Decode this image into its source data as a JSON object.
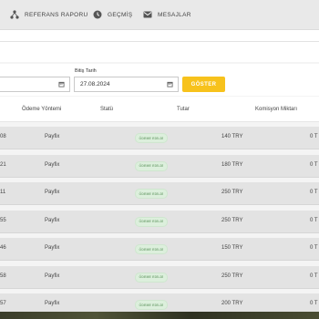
{
  "nav": {
    "items": [
      {
        "label": "REFERANS RAPORU",
        "icon": "network-icon"
      },
      {
        "label": "GEÇMİŞ",
        "icon": "history-icon"
      },
      {
        "label": "MESAJLAR",
        "icon": "mail-icon"
      }
    ]
  },
  "filters": {
    "start_value": "",
    "end_label": "Bitiş Tarih",
    "end_value": "27.08.2024",
    "show_button": "GÖSTER"
  },
  "table": {
    "headers": [
      "Ödeme Yöntemi",
      "Statü",
      "Tutar",
      "Komisyon Miktarı"
    ],
    "rows": [
      {
        "id_tail": "08",
        "method": "Payfix",
        "status": "ÖDEME EDİLDİ",
        "amount": "140 TRY",
        "commission": "0 T"
      },
      {
        "id_tail": "21",
        "method": "Payfix",
        "status": "ÖDEME EDİLDİ",
        "amount": "180 TRY",
        "commission": "0 T"
      },
      {
        "id_tail": "11",
        "method": "Payfix",
        "status": "ÖDEME EDİLDİ",
        "amount": "250 TRY",
        "commission": "0 T"
      },
      {
        "id_tail": "55",
        "method": "Payfix",
        "status": "ÖDEME EDİLDİ",
        "amount": "250 TRY",
        "commission": "0 T"
      },
      {
        "id_tail": "46",
        "method": "Payfix",
        "status": "ÖDEME EDİLDİ",
        "amount": "150 TRY",
        "commission": "0 T"
      },
      {
        "id_tail": "58",
        "method": "Payfix",
        "status": "ÖDEME EDİLDİ",
        "amount": "250 TRY",
        "commission": "0 T"
      },
      {
        "id_tail": "57",
        "method": "Payfix",
        "status": "ÖDEME EDİLDİ",
        "amount": "200 TRY",
        "commission": "0 T"
      }
    ]
  },
  "colors": {
    "accent": "#f7c21c",
    "row_bg": "#e3e3e3",
    "status_green": "#7aa87a"
  }
}
